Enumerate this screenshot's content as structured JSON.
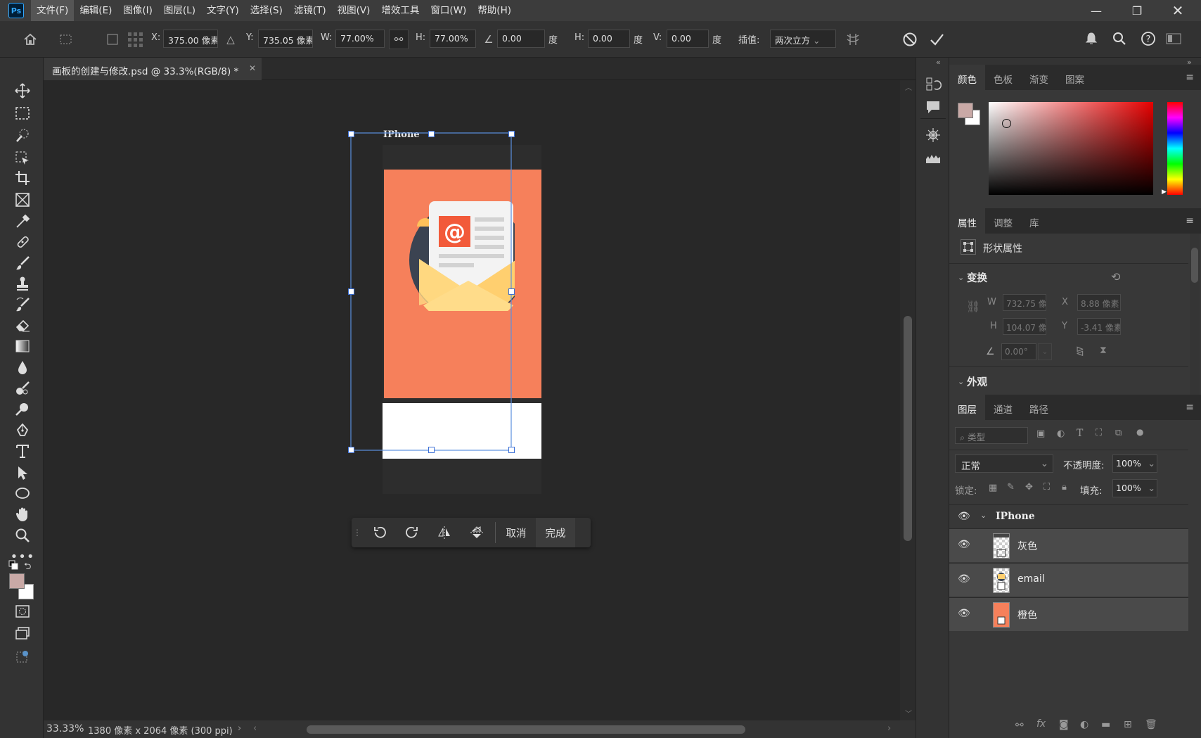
{
  "menubar": {
    "logo": "Ps",
    "items": [
      "文件(F)",
      "编辑(E)",
      "图像(I)",
      "图层(L)",
      "文字(Y)",
      "选择(S)",
      "滤镜(T)",
      "视图(V)",
      "增效工具",
      "窗口(W)",
      "帮助(H)"
    ]
  },
  "options": {
    "x_label": "X:",
    "x_value": "375.00 像素",
    "y_label": "Y:",
    "y_value": "735.05 像素",
    "w_label": "W:",
    "w_value": "77.00%",
    "h_label": "H:",
    "h_value": "77.00%",
    "angle_value": "0.00",
    "deg_label": "度",
    "hskew_label": "H:",
    "hskew_value": "0.00",
    "vskew_label": "V:",
    "vskew_value": "0.00",
    "interp_label": "插值:",
    "interp_value": "两次立方"
  },
  "document": {
    "tab_title": "画板的创建与修改.psd @ 33.3%(RGB/8) *",
    "artboard_name": "IPhone",
    "colors": {
      "orange": "#f6805b",
      "dark": "#2d2d2d",
      "white": "#ffffff",
      "navy": "#3b4351",
      "envelope": "#ffcf6f"
    }
  },
  "context_bar": {
    "cancel": "取消",
    "done": "完成"
  },
  "status": {
    "zoom": "33.33%",
    "info": "1380 像素 x 2064 像素 (300 ppi)"
  },
  "color_panel": {
    "tabs": [
      "颜色",
      "色板",
      "渐变",
      "图案"
    ],
    "foreground": "#c9a9a6",
    "background": "#ffffff"
  },
  "properties": {
    "tabs": [
      "属性",
      "调整",
      "库"
    ],
    "shape_title": "形状属性",
    "transform_title": "变换",
    "w_label": "W",
    "w_value": "732.75 像素",
    "x_label": "X",
    "x_value": "8.88 像素",
    "h_label": "H",
    "h_value": "104.07 像素",
    "y_label": "Y",
    "y_value": "-3.41 像素",
    "angle_value": "0.00°",
    "appearance_title": "外观"
  },
  "layers": {
    "tabs": [
      "图层",
      "通道",
      "路径"
    ],
    "filter_placeholder": "类型",
    "blend_mode": "正常",
    "opacity_label": "不透明度:",
    "opacity_value": "100%",
    "lock_label": "锁定:",
    "fill_label": "填充:",
    "fill_value": "100%",
    "group_name": "IPhone",
    "items": [
      {
        "name": "灰色"
      },
      {
        "name": "email"
      },
      {
        "name": "橙色"
      }
    ]
  }
}
